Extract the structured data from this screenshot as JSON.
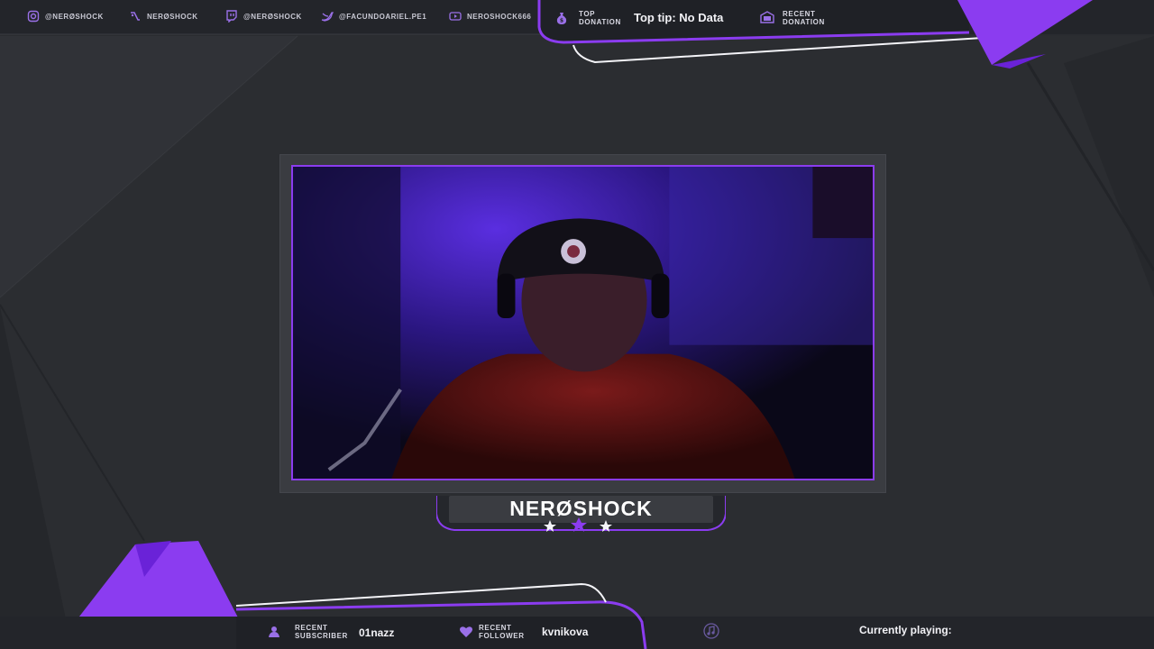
{
  "colors": {
    "accent": "#8b3cf0",
    "accent_dark": "#6a22d8",
    "background": "#2a2c30",
    "panel": "#23252a",
    "text": "#e8e8ee"
  },
  "top_bar": {
    "socials": [
      {
        "icon": "instagram-icon",
        "label": "@NERØSHOCK"
      },
      {
        "icon": "voice-icon",
        "label": "NERØSHOCK"
      },
      {
        "icon": "twitch-icon",
        "label": "@NERØSHOCK"
      },
      {
        "icon": "twitter-icon",
        "label": "@FACUNDOARIEL.PE1"
      },
      {
        "icon": "youtube-icon",
        "label": "NEROSHOCK666"
      }
    ],
    "top_donation": {
      "icon": "moneybag-icon",
      "label_line1": "TOP",
      "label_line2": "DONATION",
      "value": "Top tip: No Data"
    },
    "recent_donation": {
      "icon": "cash-icon",
      "label_line1": "RECENT",
      "label_line2": "DONATION"
    }
  },
  "stream": {
    "channel_name": "NERØSHOCK"
  },
  "bottom_bar": {
    "recent_subscriber": {
      "icon": "subscriber-icon",
      "label_line1": "RECENT",
      "label_line2": "SUBSCRIBER",
      "value": "01nazz"
    },
    "recent_follower": {
      "icon": "heart-icon",
      "label_line1": "RECENT",
      "label_line2": "FOLLOWER",
      "value": "kvnikova"
    },
    "music": {
      "icon": "music-icon",
      "label": "Currently playing:"
    }
  }
}
